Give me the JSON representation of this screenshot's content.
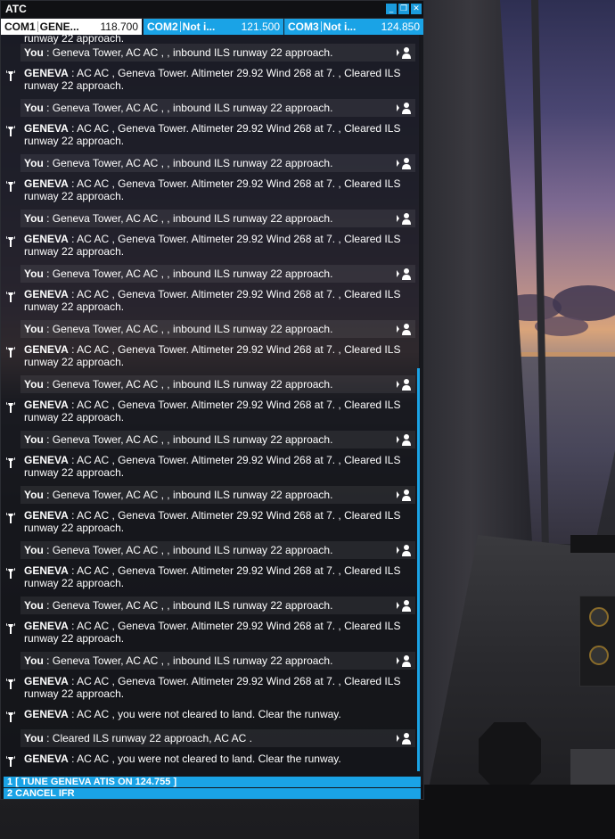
{
  "window": {
    "title": "ATC",
    "buttons": [
      "_",
      "❐",
      "✕"
    ]
  },
  "tabs": [
    {
      "name": "COM1",
      "station": "GENE...",
      "freq": "118.700",
      "active": true
    },
    {
      "name": "COM2",
      "station": "Not i...",
      "freq": "121.500",
      "active": false
    },
    {
      "name": "COM3",
      "station": "Not i...",
      "freq": "124.850",
      "active": false
    }
  ],
  "log": {
    "top_partial": "runway 22 approach.",
    "messages": [
      {
        "type": "you",
        "speaker": "You",
        "text": " : Geneva Tower, AC AC , , inbound ILS runway 22 approach."
      },
      {
        "type": "atc",
        "speaker": "GENEVA",
        "text": " : AC AC , Geneva Tower. Altimeter 29.92 Wind 268 at 7. , Cleared ILS",
        "text2": "runway 22 approach."
      },
      {
        "type": "you",
        "speaker": "You",
        "text": " : Geneva Tower, AC AC , , inbound ILS runway 22 approach."
      },
      {
        "type": "atc",
        "speaker": "GENEVA",
        "text": " : AC AC , Geneva Tower. Altimeter 29.92 Wind 268 at 7. , Cleared ILS",
        "text2": "runway 22 approach."
      },
      {
        "type": "you",
        "speaker": "You",
        "text": " : Geneva Tower, AC AC , , inbound ILS runway 22 approach."
      },
      {
        "type": "atc",
        "speaker": "GENEVA",
        "text": " : AC AC , Geneva Tower. Altimeter 29.92 Wind 268 at 7. , Cleared ILS",
        "text2": "runway 22 approach."
      },
      {
        "type": "you",
        "speaker": "You",
        "text": " : Geneva Tower, AC AC , , inbound ILS runway 22 approach."
      },
      {
        "type": "atc",
        "speaker": "GENEVA",
        "text": " : AC AC , Geneva Tower. Altimeter 29.92 Wind 268 at 7. , Cleared ILS",
        "text2": "runway 22 approach."
      },
      {
        "type": "you",
        "speaker": "You",
        "text": " : Geneva Tower, AC AC , , inbound ILS runway 22 approach."
      },
      {
        "type": "atc",
        "speaker": "GENEVA",
        "text": " : AC AC , Geneva Tower. Altimeter 29.92 Wind 268 at 7. , Cleared ILS",
        "text2": "runway 22 approach."
      },
      {
        "type": "you",
        "speaker": "You",
        "text": " : Geneva Tower, AC AC , , inbound ILS runway 22 approach."
      },
      {
        "type": "atc",
        "speaker": "GENEVA",
        "text": " : AC AC , Geneva Tower. Altimeter 29.92 Wind 268 at 7. , Cleared ILS",
        "text2": "runway 22 approach."
      },
      {
        "type": "you",
        "speaker": "You",
        "text": " : Geneva Tower, AC AC , , inbound ILS runway 22 approach."
      },
      {
        "type": "atc",
        "speaker": "GENEVA",
        "text": " : AC AC , Geneva Tower. Altimeter 29.92 Wind 268 at 7. , Cleared ILS",
        "text2": "runway 22 approach."
      },
      {
        "type": "you",
        "speaker": "You",
        "text": " : Geneva Tower, AC AC , , inbound ILS runway 22 approach."
      },
      {
        "type": "atc",
        "speaker": "GENEVA",
        "text": " : AC AC , Geneva Tower. Altimeter 29.92 Wind 268 at 7. , Cleared ILS",
        "text2": "runway 22 approach."
      },
      {
        "type": "you",
        "speaker": "You",
        "text": " : Geneva Tower, AC AC , , inbound ILS runway 22 approach."
      },
      {
        "type": "atc",
        "speaker": "GENEVA",
        "text": " : AC AC , Geneva Tower. Altimeter 29.92 Wind 268 at 7. , Cleared ILS",
        "text2": "runway 22 approach."
      },
      {
        "type": "you",
        "speaker": "You",
        "text": " : Geneva Tower, AC AC , , inbound ILS runway 22 approach."
      },
      {
        "type": "atc",
        "speaker": "GENEVA",
        "text": " : AC AC , Geneva Tower. Altimeter 29.92 Wind 268 at 7. , Cleared ILS",
        "text2": "runway 22 approach."
      },
      {
        "type": "you",
        "speaker": "You",
        "text": " : Geneva Tower, AC AC , , inbound ILS runway 22 approach."
      },
      {
        "type": "atc",
        "speaker": "GENEVA",
        "text": " : AC AC , Geneva Tower. Altimeter 29.92 Wind 268 at 7. , Cleared ILS",
        "text2": "runway 22 approach."
      },
      {
        "type": "you",
        "speaker": "You",
        "text": " : Geneva Tower, AC AC , , inbound ILS runway 22 approach."
      },
      {
        "type": "atc",
        "speaker": "GENEVA",
        "text": " : AC AC , Geneva Tower. Altimeter 29.92 Wind 268 at 7. , Cleared ILS",
        "text2": "runway 22 approach."
      },
      {
        "type": "atc1",
        "speaker": "GENEVA",
        "text": " : AC AC , you were not cleared to land. Clear the runway."
      },
      {
        "type": "you",
        "speaker": "You",
        "text": " : Cleared ILS runway 22 approach, AC AC ."
      },
      {
        "type": "atc1",
        "speaker": "GENEVA",
        "text": " : AC AC , you were not cleared to land. Clear the runway."
      }
    ]
  },
  "options": [
    "1  [ TUNE GENEVA ATIS ON 124.755 ]",
    "2  CANCEL IFR"
  ],
  "colors": {
    "accent": "#1aa3e6",
    "panel": "#121318",
    "text": "#ffffff"
  },
  "icons": {
    "user": "user-icon",
    "tower": "tower-icon",
    "arrow": "chevron-right-icon"
  }
}
